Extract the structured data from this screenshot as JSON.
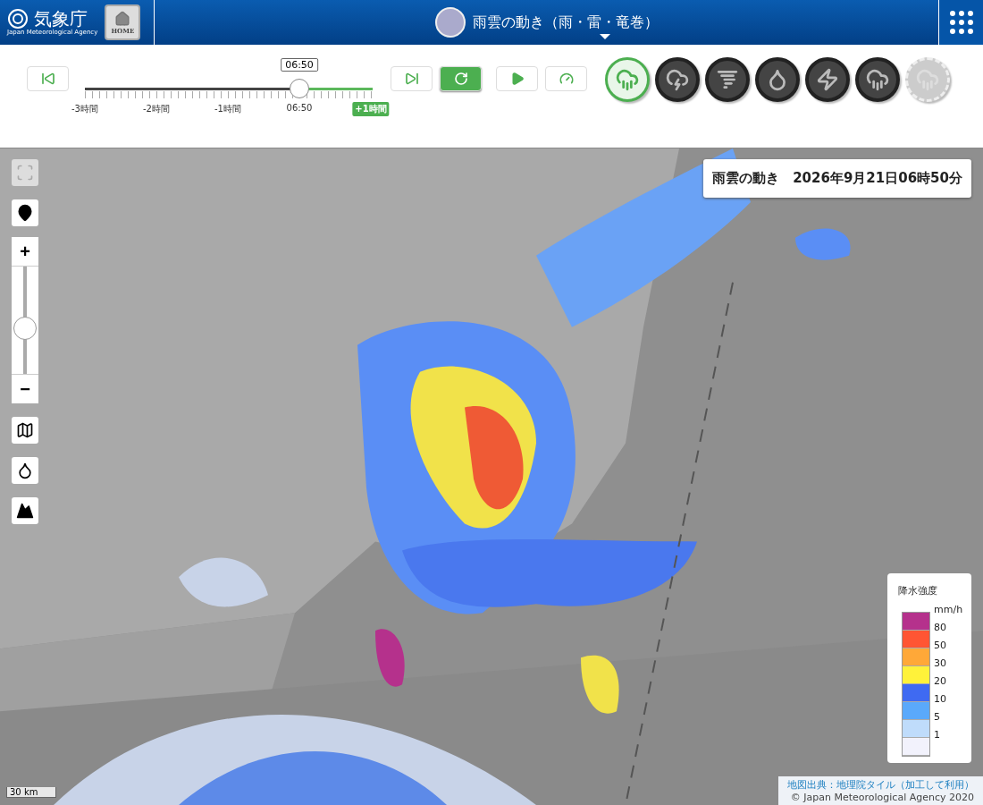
{
  "header": {
    "logo_text": "気象庁",
    "logo_subtitle": "Japan Meteorological Agency",
    "home_button": "HOME",
    "title": "雨雲の動き（雨・雷・竜巻）"
  },
  "timeline": {
    "time_bubble": "06:50",
    "level": 0.75,
    "tick_labels": [
      {
        "label": "-3時間",
        "highlighted": false
      },
      {
        "label": "-2時間",
        "highlighted": false
      },
      {
        "label": "-1時間",
        "highlighted": false
      },
      {
        "label": "06:50",
        "highlighted": false
      },
      {
        "label": "+1時間",
        "highlighted": true
      }
    ]
  },
  "playback_buttons": [
    {
      "kind": "first",
      "selected": false
    },
    {
      "kind": "last",
      "selected": false
    },
    {
      "kind": "refresh",
      "selected": true
    },
    {
      "kind": "play",
      "selected": false
    },
    {
      "kind": "speed",
      "selected": false
    }
  ],
  "layers": [
    {
      "kind": "rain",
      "selected": true,
      "disabled": false
    },
    {
      "kind": "thunder",
      "selected": false,
      "disabled": false
    },
    {
      "kind": "tornado",
      "selected": false,
      "disabled": false
    },
    {
      "kind": "drop",
      "selected": false,
      "disabled": false
    },
    {
      "kind": "lightning",
      "selected": false,
      "disabled": false
    },
    {
      "kind": "rain_band",
      "selected": false,
      "disabled": false
    },
    {
      "kind": "rain_band",
      "selected": false,
      "disabled": true
    }
  ],
  "map": {
    "title_box": "雨雲の動き　2026年9月21日06時50分",
    "zoom_in": "+",
    "zoom_out": "−",
    "zoom_slider": {
      "level": 0.4
    },
    "side_buttons": [
      {
        "kind": "fullscreen",
        "disabled": true
      },
      {
        "kind": "pin",
        "disabled": false
      }
    ],
    "lower_buttons": [
      {
        "kind": "map"
      },
      {
        "kind": "drop"
      },
      {
        "kind": "mountain"
      }
    ],
    "scale": "30 km",
    "legend": {
      "title": "降水強度",
      "unit": "mm/h",
      "levels": [
        {
          "color": "#b5318c",
          "label": "80"
        },
        {
          "color": "#ff5533",
          "label": "50"
        },
        {
          "color": "#ffa838",
          "label": "30"
        },
        {
          "color": "#fff23a",
          "label": "20"
        },
        {
          "color": "#3f6af2",
          "label": "10"
        },
        {
          "color": "#5aa9fb",
          "label": "5"
        },
        {
          "color": "#bfdcfb",
          "label": "1"
        },
        {
          "color": "#f2f2fc"
        }
      ]
    },
    "attribution": [
      "地図出典：地理院タイル（加工して利用）",
      "© Japan Meteorological Agency 2020"
    ]
  }
}
